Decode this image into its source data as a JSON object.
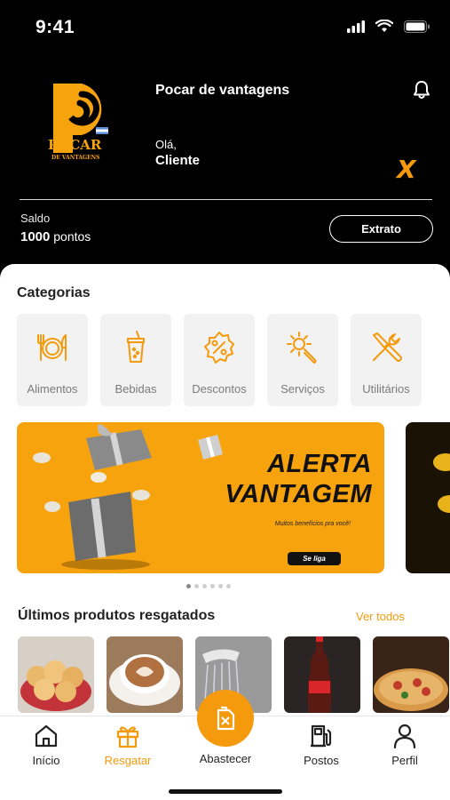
{
  "status_bar": {
    "time": "9:41"
  },
  "header": {
    "app_name": "Pocar de vantagens",
    "greeting": "Olá,",
    "user_name": "Cliente",
    "logo_text": "POCAR",
    "logo_subtext": "DE VANTAGENS",
    "badge": "X",
    "saldo_label": "Saldo",
    "saldo_points": "1000",
    "saldo_unit": "pontos",
    "extrato_label": "Extrato"
  },
  "categorias": {
    "title": "Categorias",
    "items": [
      {
        "label": "Alimentos",
        "icon": "cutlery-plate-icon"
      },
      {
        "label": "Bebidas",
        "icon": "drink-cup-icon"
      },
      {
        "label": "Descontos",
        "icon": "discount-badge-icon"
      },
      {
        "label": "Serviços",
        "icon": "wrench-gear-icon"
      },
      {
        "label": "Utilitários",
        "icon": "tools-icon"
      }
    ]
  },
  "banner": {
    "title_line1": "ALERTA",
    "title_line2": "VANTAGEM",
    "subtitle": "Muitos benefícios pra você!",
    "cta": "Se liga",
    "active_index": 0,
    "total": 6
  },
  "produtos": {
    "title": "Últimos produtos resgatados",
    "link": "Ver todos",
    "items": [
      {
        "name": "pão de queijo"
      },
      {
        "name": "cappuccino"
      },
      {
        "name": "chuveiro"
      },
      {
        "name": "coca-cola"
      },
      {
        "name": "pizza"
      }
    ]
  },
  "nav": {
    "items": [
      {
        "label": "Início",
        "icon": "home-icon"
      },
      {
        "label": "Resgatar",
        "icon": "gift-icon",
        "active": true
      },
      {
        "label": "Abastecer",
        "icon": "fuel-can-icon"
      },
      {
        "label": "Postos",
        "icon": "gas-station-icon"
      },
      {
        "label": "Perfil",
        "icon": "person-icon"
      }
    ]
  },
  "colors": {
    "accent": "#f59a0c",
    "header_bg": "#000000",
    "banner_bg": "#f7a30e"
  }
}
